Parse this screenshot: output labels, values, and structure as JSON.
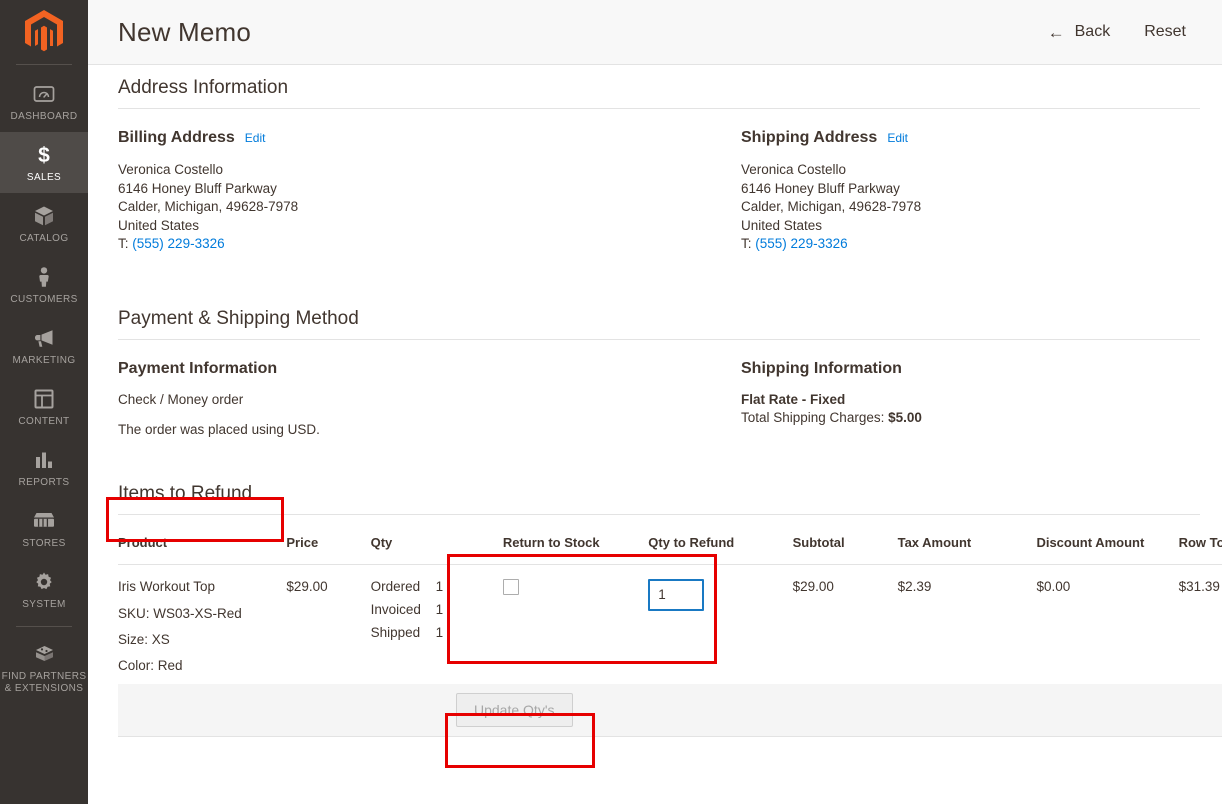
{
  "sidebar": {
    "logo_name": "magento-logo",
    "items": [
      {
        "label": "Dashboard",
        "icon": "dashboard-icon",
        "active": false
      },
      {
        "label": "Sales",
        "icon": "dollar-icon",
        "active": true
      },
      {
        "label": "Catalog",
        "icon": "box-icon",
        "active": false
      },
      {
        "label": "Customers",
        "icon": "person-icon",
        "active": false
      },
      {
        "label": "Marketing",
        "icon": "megaphone-icon",
        "active": false
      },
      {
        "label": "Content",
        "icon": "layout-icon",
        "active": false
      },
      {
        "label": "Reports",
        "icon": "bar-chart-icon",
        "active": false
      },
      {
        "label": "Stores",
        "icon": "storefront-icon",
        "active": false
      },
      {
        "label": "System",
        "icon": "gear-icon",
        "active": false
      }
    ],
    "footer_item": {
      "label": "Find Partners\n& Extensions",
      "line1": "Find Partners",
      "line2": "& Extensions",
      "icon": "blocks-icon"
    }
  },
  "header": {
    "title": "New Memo",
    "back_label": "Back",
    "back_icon": "arrow-left-icon",
    "reset_label": "Reset"
  },
  "address_section": {
    "title": "Address Information",
    "billing": {
      "heading": "Billing Address",
      "edit_label": "Edit",
      "name": "Veronica Costello",
      "street": "6146 Honey Bluff Parkway",
      "city_state_zip": "Calder, Michigan, 49628-7978",
      "country": "United States",
      "phone_prefix": "T:",
      "phone": "(555) 229-3326"
    },
    "shipping": {
      "heading": "Shipping Address",
      "edit_label": "Edit",
      "name": "Veronica Costello",
      "street": "6146 Honey Bluff Parkway",
      "city_state_zip": "Calder, Michigan, 49628-7978",
      "country": "United States",
      "phone_prefix": "T:",
      "phone": "(555) 229-3326"
    }
  },
  "method_section": {
    "title": "Payment & Shipping Method",
    "payment": {
      "heading": "Payment Information",
      "method": "Check / Money order",
      "note": "The order was placed using USD."
    },
    "shipping": {
      "heading": "Shipping Information",
      "method": "Flat Rate - Fixed",
      "charges_label": "Total Shipping Charges:",
      "charges_value": "$5.00"
    }
  },
  "items_section": {
    "title": "Items to Refund",
    "columns": [
      "Product",
      "Price",
      "Qty",
      "Return to Stock",
      "Qty to Refund",
      "Subtotal",
      "Tax Amount",
      "Discount Amount",
      "Row Total"
    ],
    "rows": [
      {
        "product_name": "Iris Workout Top",
        "sku": "SKU: WS03-XS-Red",
        "size": "Size: XS",
        "color": "Color: Red",
        "price": "$29.00",
        "qty": [
          {
            "label": "Ordered",
            "value": "1"
          },
          {
            "label": "Invoiced",
            "value": "1"
          },
          {
            "label": "Shipped",
            "value": "1"
          }
        ],
        "return_to_stock_checked": false,
        "qty_to_refund": "1",
        "subtotal": "$29.00",
        "tax_amount": "$2.39",
        "discount_amount": "$0.00",
        "row_total": "$31.39"
      }
    ],
    "update_button_label": "Update Qty's"
  },
  "highlights": {
    "accent_color": "#e60000",
    "boxes": [
      "items-to-refund-title",
      "refund-columns",
      "update-qtys-button"
    ]
  },
  "colors": {
    "brand_orange": "#f26322",
    "sidebar_bg": "#373330",
    "link_blue": "#007bdb",
    "input_focus_blue": "#1979c3",
    "text": "#41362f"
  }
}
